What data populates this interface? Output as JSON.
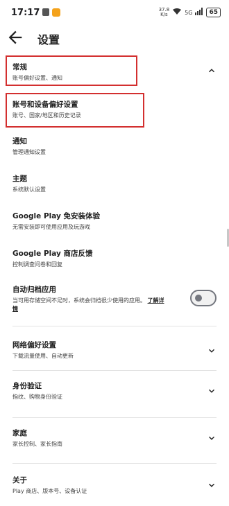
{
  "status_bar": {
    "time": "17:17",
    "net_speed_value": "37.8",
    "net_speed_unit": "K/s",
    "network": "5G",
    "battery": "65"
  },
  "app_bar": {
    "title": "设置",
    "back_icon": "arrow-back-icon"
  },
  "sections": {
    "general": {
      "title": "常规",
      "subtitle": "账号偏好设置、通知"
    },
    "account": {
      "title": "账号和设备偏好设置",
      "subtitle": "账号、国家/地区和历史记录"
    },
    "notifications": {
      "title": "通知",
      "subtitle": "管理通知设置"
    },
    "theme": {
      "title": "主题",
      "subtitle": "系统默认设置"
    },
    "instant": {
      "title": "Google Play 免安装体验",
      "subtitle": "无需安装即可使用应用及玩游戏"
    },
    "feedback": {
      "title": "Google Play 商店反馈",
      "subtitle": "控制调查问卷和回复"
    },
    "auto_archive": {
      "title": "自动归档应用",
      "subtitle": "当可用存储空间不足时，系统会归档很少使用的应用。",
      "learn_more": "了解详",
      "subtitle_wrap": "情",
      "toggle_on": false
    },
    "network_prefs": {
      "title": "网络偏好设置",
      "subtitle": "下载流量使用、自动更新"
    },
    "auth": {
      "title": "身份验证",
      "subtitle": "指纹、购物身份验证"
    },
    "family": {
      "title": "家庭",
      "subtitle": "家长控制、家长指南"
    },
    "about": {
      "title": "关于",
      "subtitle": "Play 商店、版本号、设备认证"
    }
  },
  "colors": {
    "highlight_border": "#d32f2f",
    "text": "#1f1f1f"
  }
}
